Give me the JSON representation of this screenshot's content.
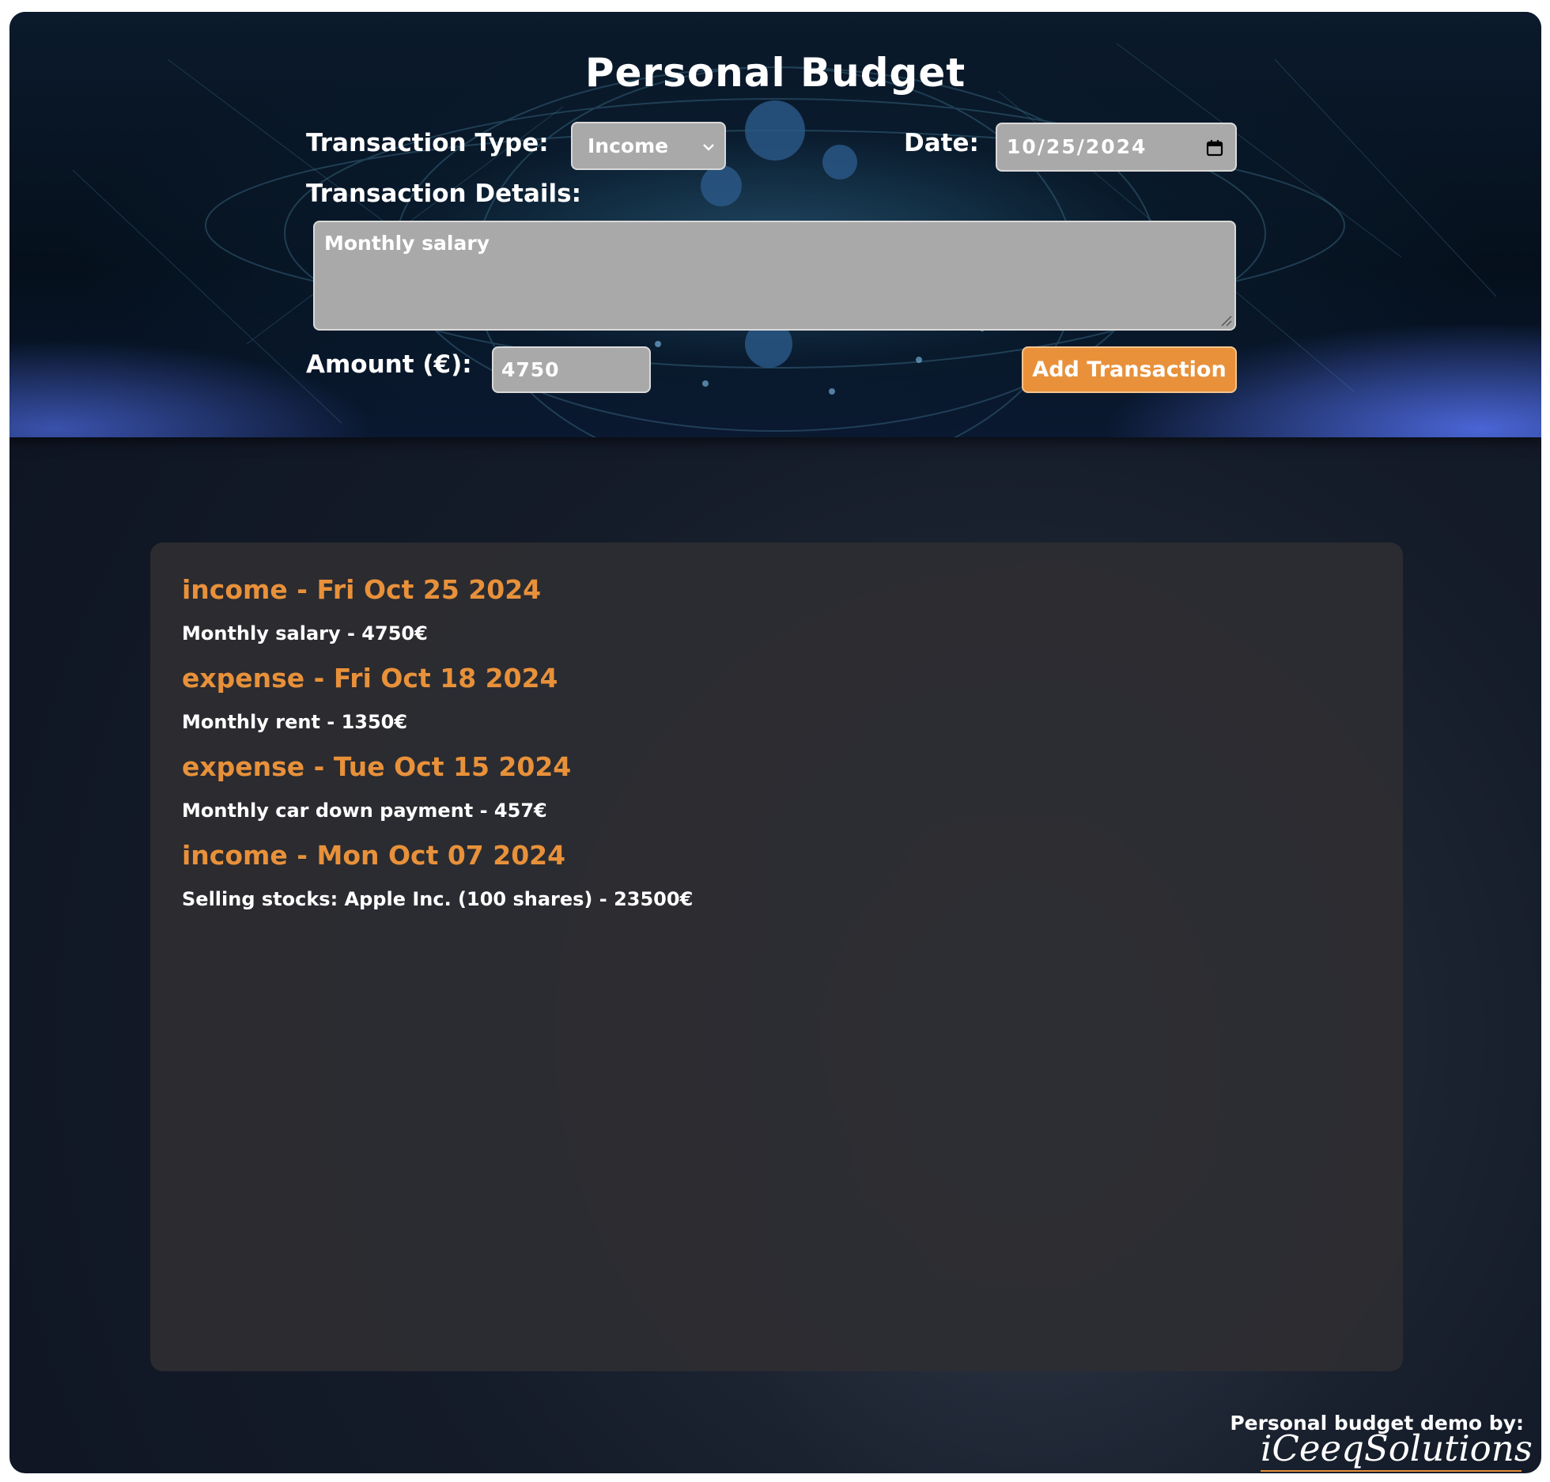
{
  "header": {
    "title": "Personal Budget",
    "transaction_type_label": "Transaction Type:",
    "transaction_type_value": "Income",
    "date_label": "Date:",
    "date_value": "10/25/2024",
    "details_label": "Transaction Details:",
    "details_value": "Monthly salary",
    "amount_label": "Amount (€):",
    "amount_value": "4750",
    "add_button_label": "Add Transaction"
  },
  "transactions": [
    {
      "heading": "income - Fri Oct 25 2024",
      "detail": "Monthly salary - 4750€"
    },
    {
      "heading": "expense - Fri Oct 18 2024",
      "detail": "Monthly rent - 1350€"
    },
    {
      "heading": "expense - Tue Oct 15 2024",
      "detail": "Monthly car down payment - 457€"
    },
    {
      "heading": "income - Mon Oct 07 2024",
      "detail": "Selling stocks: Apple Inc. (100 shares) - 23500€"
    }
  ],
  "footer": {
    "credit_text": "Personal budget demo by:",
    "logo_text": "iCeeqSolutions"
  },
  "colors": {
    "accent": "#e8913a",
    "field_bg": "#a9a9a9",
    "panel_bg": "#2d2d32",
    "page_bg": "#141b29"
  },
  "icons": {
    "type_select": "chevron-down-icon",
    "date_picker": "calendar-icon",
    "details_resize": "resize-grip-icon"
  }
}
